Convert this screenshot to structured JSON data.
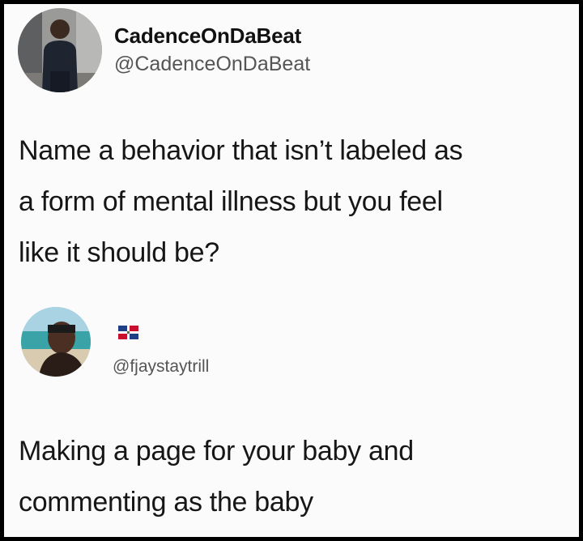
{
  "tweet": {
    "display_name": "CadenceOnDaBeat",
    "handle": "@CadenceOnDaBeat",
    "text": "Name a behavior that isn’t labeled as\na form of mental illness but you feel\nlike it should be?",
    "avatar_icon": "profile-photo-man-standing"
  },
  "reply": {
    "flag_icon": "dominican-republic-flag",
    "handle": "@fjaystaytrill",
    "text": "Making a page for your baby and\ncommenting as the baby",
    "avatar_icon": "profile-photo-man-beach"
  },
  "colors": {
    "background": "#fbfbfb",
    "border": "#000000",
    "text": "#161616",
    "muted": "#555555"
  }
}
